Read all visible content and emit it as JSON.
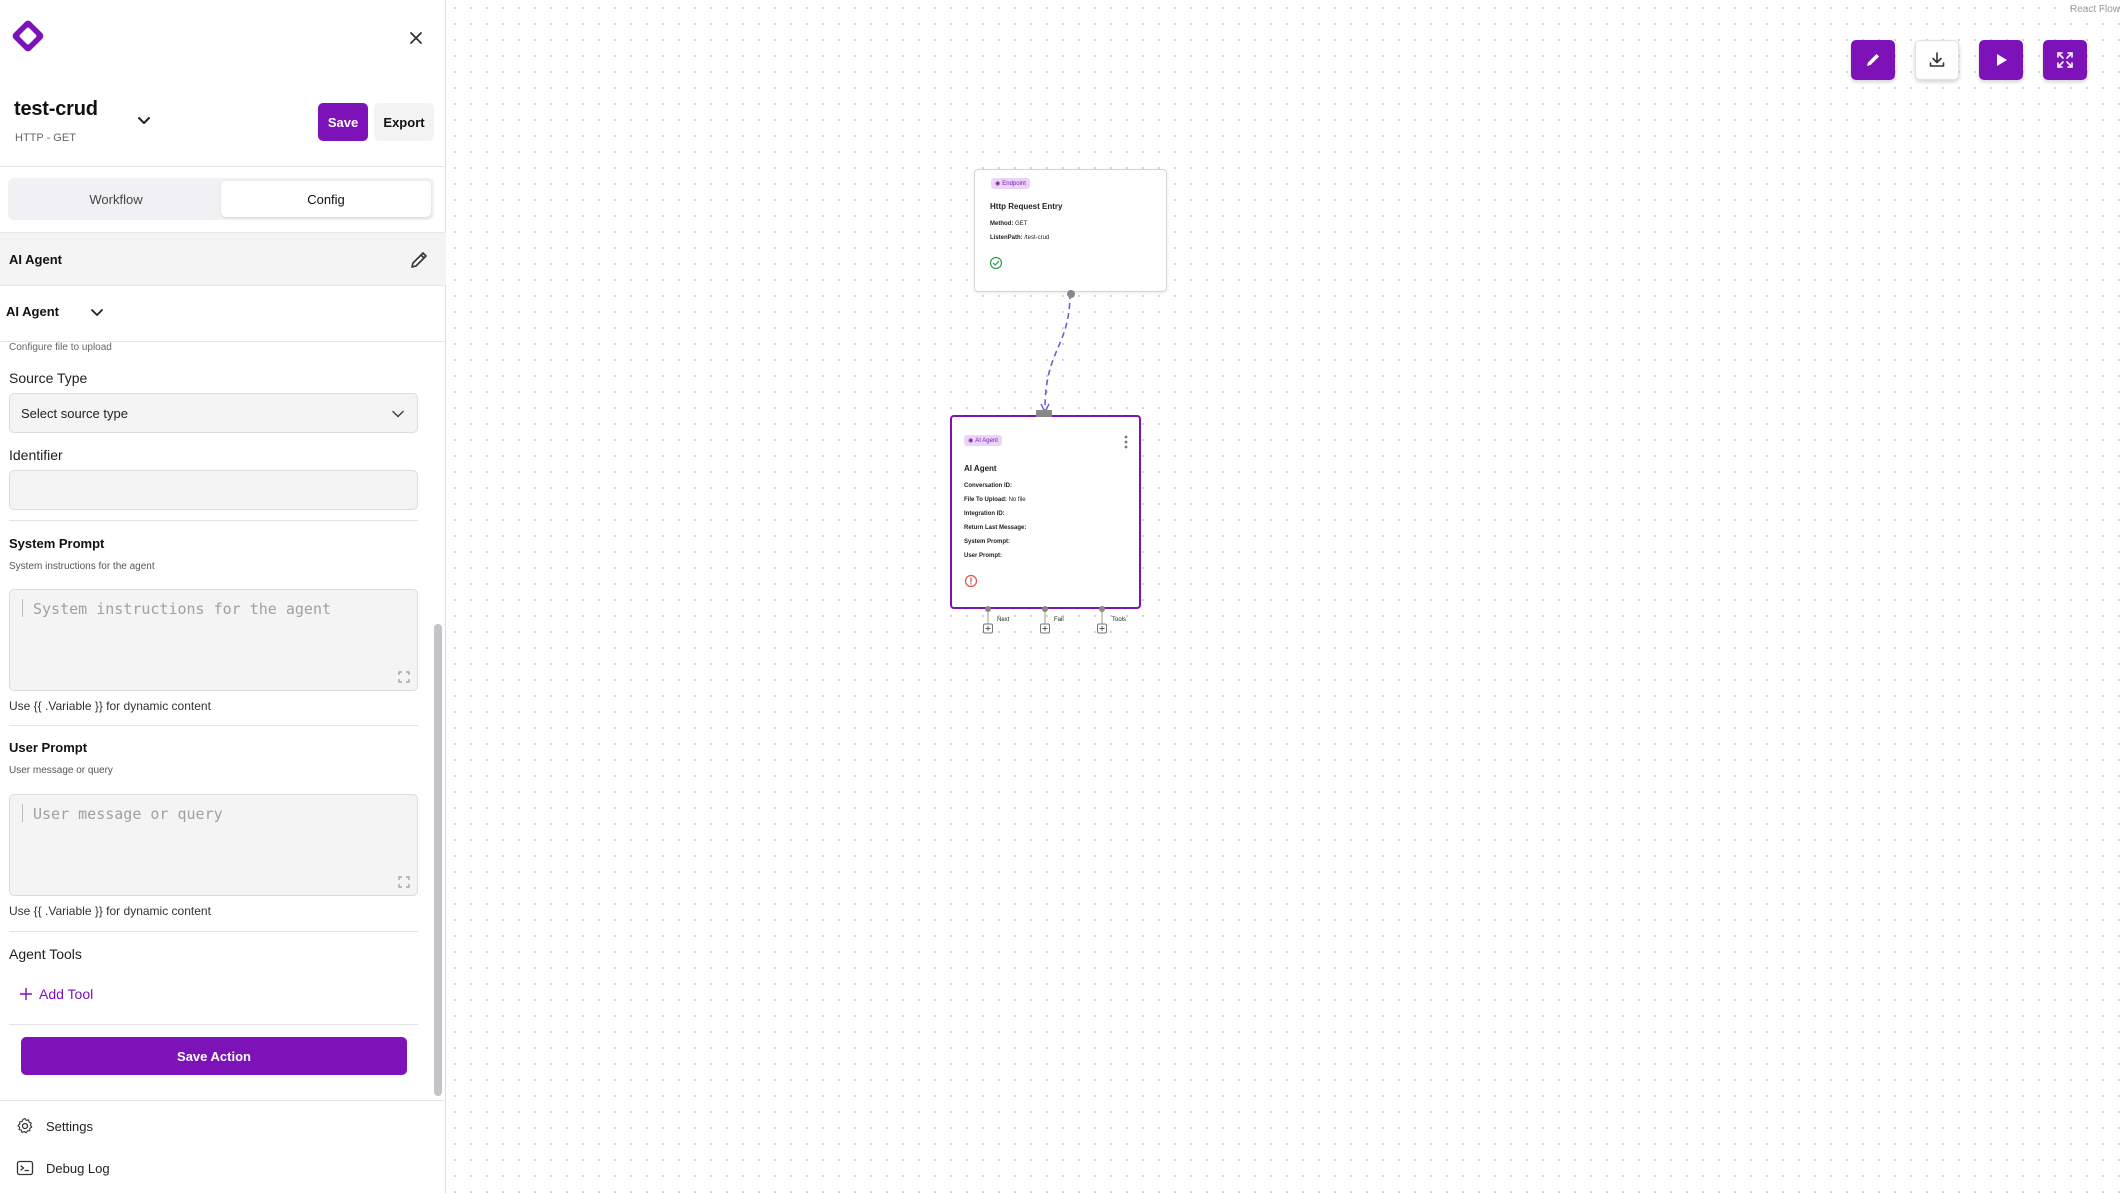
{
  "project": {
    "name": "test-crud",
    "subtitle": "HTTP - GET"
  },
  "header": {
    "save_label": "Save",
    "export_label": "Export"
  },
  "tabs": [
    {
      "label": "Workflow",
      "active": false
    },
    {
      "label": "Config",
      "active": true
    }
  ],
  "config": {
    "section_title": "AI Agent",
    "selected_action": "AI Agent",
    "file_desc": "Configure file to upload",
    "source_type": {
      "label": "Source Type",
      "placeholder": "Select source type"
    },
    "identifier": {
      "label": "Identifier",
      "value": ""
    },
    "system_prompt": {
      "title": "System Prompt",
      "desc": "System instructions for the agent",
      "placeholder": "System instructions for the agent",
      "hint": "Use {{ .Variable }} for dynamic content"
    },
    "user_prompt": {
      "title": "User Prompt",
      "desc": "User message or query",
      "placeholder": "User message or query",
      "hint": "Use {{ .Variable }} for dynamic content"
    },
    "agent_tools": {
      "title": "Agent Tools",
      "add_label": "Add Tool"
    },
    "save_action_label": "Save Action"
  },
  "nav": {
    "settings": "Settings",
    "debug_log": "Debug Log"
  },
  "canvas": {
    "attribution": "React Flow",
    "nodes": {
      "entry": {
        "badge": "Endpoint",
        "title": "Http Request Entry",
        "method_label": "Method:",
        "method_value": "GET",
        "path_label": "ListenPath:",
        "path_value": "/test-crud"
      },
      "agent": {
        "badge": "AI Agent",
        "title": "AI Agent",
        "fields": [
          {
            "label": "Conversation ID:",
            "value": ""
          },
          {
            "label": "File To Upload:",
            "value": "No file"
          },
          {
            "label": "Integration ID:",
            "value": ""
          },
          {
            "label": "Return Last Message:",
            "value": ""
          },
          {
            "label": "System Prompt:",
            "value": ""
          },
          {
            "label": "User Prompt:",
            "value": ""
          }
        ],
        "handles": [
          "Next",
          "Fail",
          "Tools"
        ]
      }
    }
  },
  "colors": {
    "accent": "#7d12b8",
    "success": "#2e9e4f",
    "error": "#d9534f",
    "edge": "#6b5fd6"
  }
}
